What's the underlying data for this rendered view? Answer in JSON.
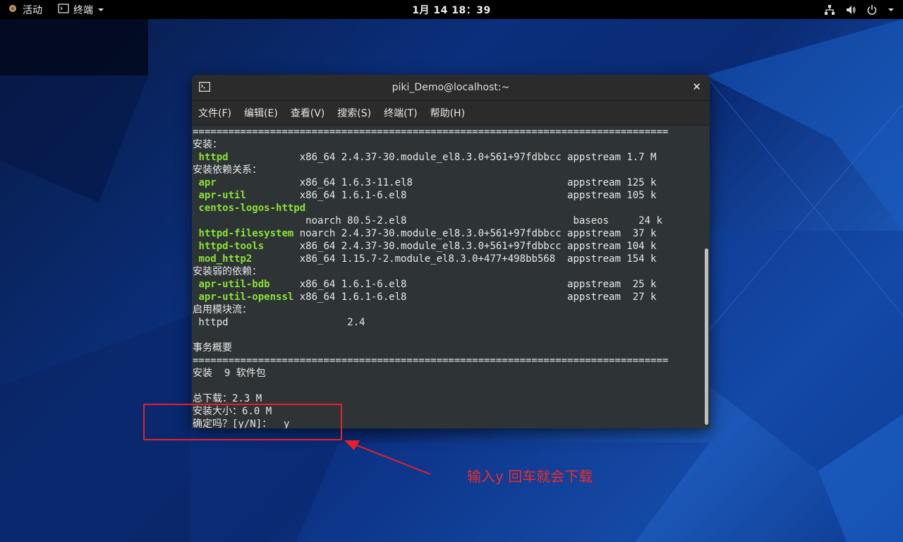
{
  "topbar": {
    "activities": "活动",
    "app_name": "终端",
    "clock": "1月 14  18：39"
  },
  "window": {
    "title": "piki_Demo@localhost:~",
    "menu": [
      "文件(F)",
      "编辑(E)",
      "查看(V)",
      "搜索(S)",
      "终端(T)",
      "帮助(H)"
    ]
  },
  "terminal": {
    "separator": "================================================================================",
    "install_header": "安装：",
    "deps_header": "安装依赖关系：",
    "weak_header": "安装弱的依赖：",
    "modules_header": "启用模块流：",
    "summary_header": "事务概要",
    "rows": [
      {
        "name": "httpd",
        "arch": "x86_64",
        "version": "2.4.37-30.module_el8.3.0+561+97fdbbcc",
        "repo": "appstream",
        "size": "1.7 M"
      },
      {
        "name": "apr",
        "arch": "x86_64",
        "version": "1.6.3-11.el8",
        "repo": "appstream",
        "size": "125 k"
      },
      {
        "name": "apr-util",
        "arch": "x86_64",
        "version": "1.6.1-6.el8",
        "repo": "appstream",
        "size": "105 k"
      },
      {
        "name": "centos-logos-httpd",
        "arch": "noarch",
        "version": "80.5-2.el8",
        "repo": "baseos",
        "size": " 24 k"
      },
      {
        "name": "httpd-filesystem",
        "arch": "noarch",
        "version": "2.4.37-30.module_el8.3.0+561+97fdbbcc",
        "repo": "appstream",
        "size": " 37 k"
      },
      {
        "name": "httpd-tools",
        "arch": "x86_64",
        "version": "2.4.37-30.module_el8.3.0+561+97fdbbcc",
        "repo": "appstream",
        "size": "104 k"
      },
      {
        "name": "mod_http2",
        "arch": "x86_64",
        "version": "1.15.7-2.module_el8.3.0+477+498bb568",
        "repo": "appstream",
        "size": "154 k"
      },
      {
        "name": "apr-util-bdb",
        "arch": "x86_64",
        "version": "1.6.1-6.el8",
        "repo": "appstream",
        "size": " 25 k"
      },
      {
        "name": "apr-util-openssl",
        "arch": "x86_64",
        "version": "1.6.1-6.el8",
        "repo": "appstream",
        "size": " 27 k"
      }
    ],
    "module_row": " httpd                    2.4",
    "install_count": "安装  9 软件包",
    "total_download": "总下载：2.3 M",
    "installed_size": "安装大小：6.0 M",
    "confirm_prompt": "确定吗？[y/N]：  y"
  },
  "annotation": {
    "text": "输入y 回车就会下载",
    "color": "#e8202a"
  }
}
